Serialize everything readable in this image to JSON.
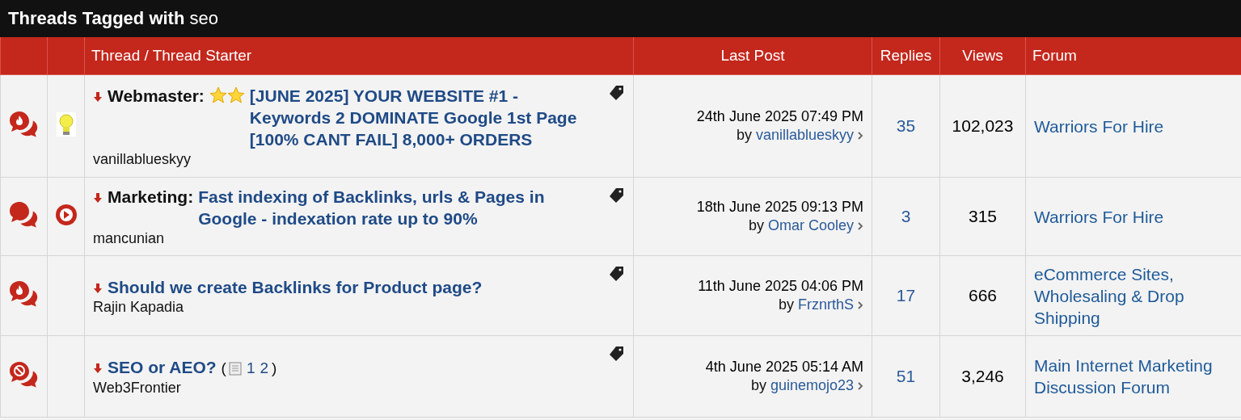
{
  "heading": {
    "label": "Threads Tagged with",
    "tag": "seo"
  },
  "columns": [
    "Thread / Thread Starter",
    "Last Post",
    "Replies",
    "Views",
    "Forum"
  ],
  "threads": [
    {
      "status_icon": {
        "kind": "hot"
      },
      "post_icon": {
        "kind": "lightbulb"
      },
      "prefix": "Webmaster:",
      "title_badge": {
        "kind": "two-stars"
      },
      "title": "[JUNE 2025] YOUR WEBSITE #1 - Keywords 2 DOMINATE Google 1st Page [100% CANT FAIL] 8,000+ ORDERS",
      "tagged": true,
      "starter": "vanillablueskyy",
      "last_post_date": "24th June 2025 07:49 PM",
      "by": "by",
      "last_poster": "vanillablueskyy",
      "replies": "35",
      "views": "102,023",
      "forum": "Warriors For Hire"
    },
    {
      "status_icon": {
        "kind": "normal"
      },
      "post_icon": {
        "kind": "play"
      },
      "prefix": "Marketing:",
      "title": "Fast indexing of Backlinks, urls & Pages in Google - indexation rate up to 90%",
      "tagged": true,
      "starter": "mancunian",
      "last_post_date": "18th June 2025 09:13 PM",
      "by": "by",
      "last_poster": "Omar Cooley",
      "replies": "3",
      "views": "315",
      "forum": "Warriors For Hire"
    },
    {
      "status_icon": {
        "kind": "hot"
      },
      "title": "Should we create Backlinks for Product page?",
      "tagged": true,
      "starter": "Rajin Kapadia",
      "last_post_date": "11th June 2025 04:06 PM",
      "by": "by",
      "last_poster": "FrznrthS",
      "replies": "17",
      "views": "666",
      "forum": "eCommerce Sites, Wholesaling & Drop Shipping"
    },
    {
      "status_icon": {
        "kind": "closed"
      },
      "title": "SEO or AEO?",
      "pages": [
        "1",
        "2"
      ],
      "open_paren": "(",
      "close_paren": ")",
      "tagged": true,
      "starter": "Web3Frontier",
      "last_post_date": "4th June 2025 05:14 AM",
      "by": "by",
      "last_poster": "guinemojo23",
      "replies": "51",
      "views": "3,246",
      "forum": "Main Internet Marketing Discussion Forum"
    }
  ]
}
